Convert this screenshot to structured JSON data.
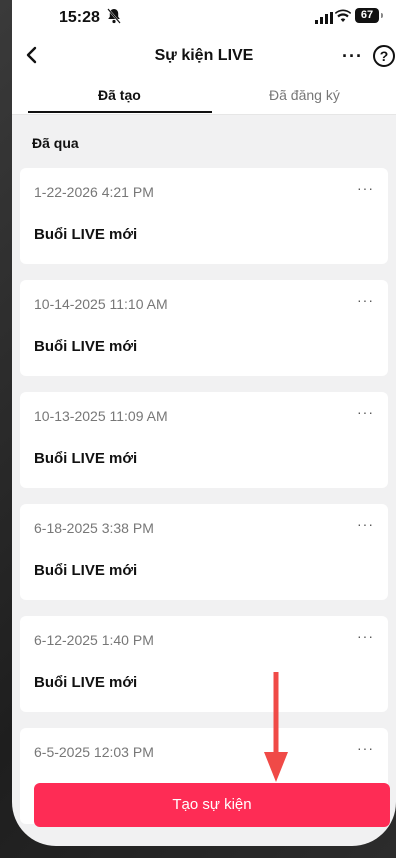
{
  "status_bar": {
    "time": "15:28",
    "battery": "67"
  },
  "header": {
    "title": "Sự kiện LIVE",
    "more": "···",
    "help": "?"
  },
  "tabs": [
    {
      "label": "Đã tạo",
      "active": true
    },
    {
      "label": "Đã đăng ký",
      "active": false
    }
  ],
  "section": {
    "label": "Đã qua"
  },
  "events": [
    {
      "date": "1-22-2026 4:21 PM",
      "name": "Buổi LIVE mới"
    },
    {
      "date": "10-14-2025 11:10 AM",
      "name": "Buổi LIVE mới"
    },
    {
      "date": "10-13-2025 11:09 AM",
      "name": "Buổi LIVE mới"
    },
    {
      "date": "6-18-2025 3:38 PM",
      "name": "Buổi LIVE mới"
    },
    {
      "date": "6-12-2025 1:40 PM",
      "name": "Buổi LIVE mới"
    },
    {
      "date": "6-5-2025 12:03 PM",
      "name": ""
    }
  ],
  "card_more": "···",
  "create_button": {
    "label": "Tạo sự kiện"
  },
  "colors": {
    "accent": "#fe2c55",
    "annotation_arrow": "#f04a47"
  }
}
